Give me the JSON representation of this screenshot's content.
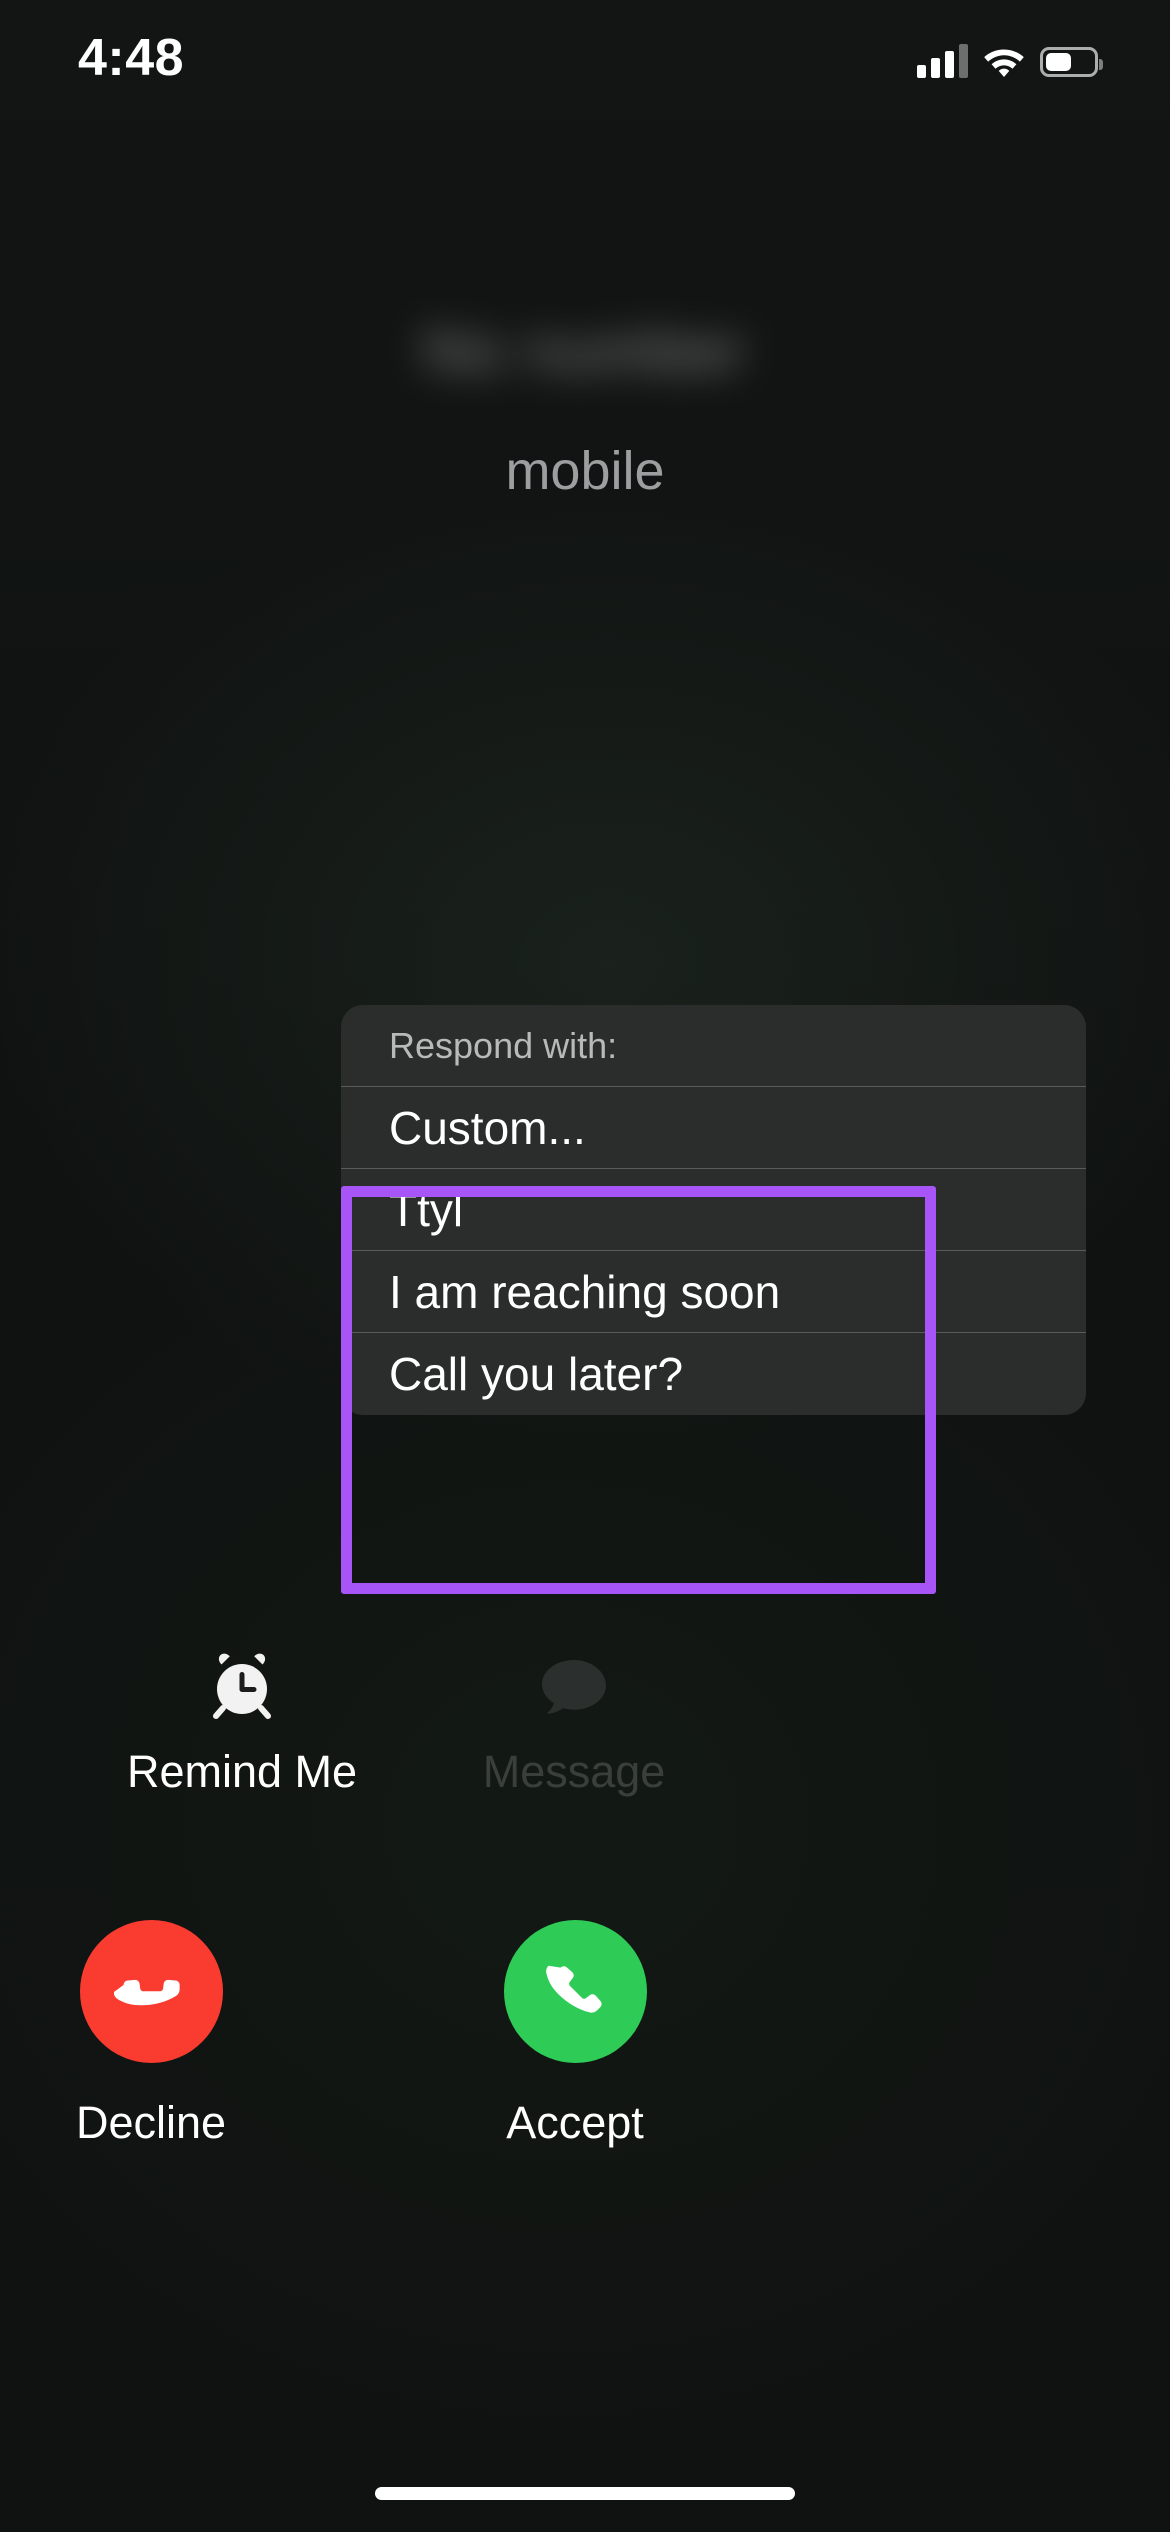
{
  "status_bar": {
    "time": "4:48",
    "signal_icon": "cellular-signal-icon",
    "signal_bars_filled": 3,
    "signal_bars_total": 4,
    "wifi_icon": "wifi-icon",
    "battery_icon": "battery-icon",
    "battery_level_percent": 48
  },
  "caller": {
    "name": "No number",
    "name_redacted": true,
    "label": "mobile"
  },
  "respond_panel": {
    "header": "Respond with:",
    "items": [
      {
        "label": "Custom...",
        "highlighted": false
      },
      {
        "label": "Ttyl",
        "highlighted": true
      },
      {
        "label": "I am reaching soon",
        "highlighted": true
      },
      {
        "label": "Call you later?",
        "highlighted": true
      }
    ]
  },
  "annotation": {
    "color": "#a855f7",
    "shape": "rectangle"
  },
  "secondary_actions": [
    {
      "label": "Remind Me",
      "icon": "alarm-clock-icon",
      "state": "enabled"
    },
    {
      "label": "Message",
      "icon": "message-bubble-icon",
      "state": "dimmed"
    }
  ],
  "call_actions": [
    {
      "label": "Decline",
      "icon": "phone-decline-icon",
      "color": "#fa3c30"
    },
    {
      "label": "Accept",
      "icon": "phone-accept-icon",
      "color": "#2ecc57"
    }
  ],
  "home_indicator": {
    "visible": true
  }
}
